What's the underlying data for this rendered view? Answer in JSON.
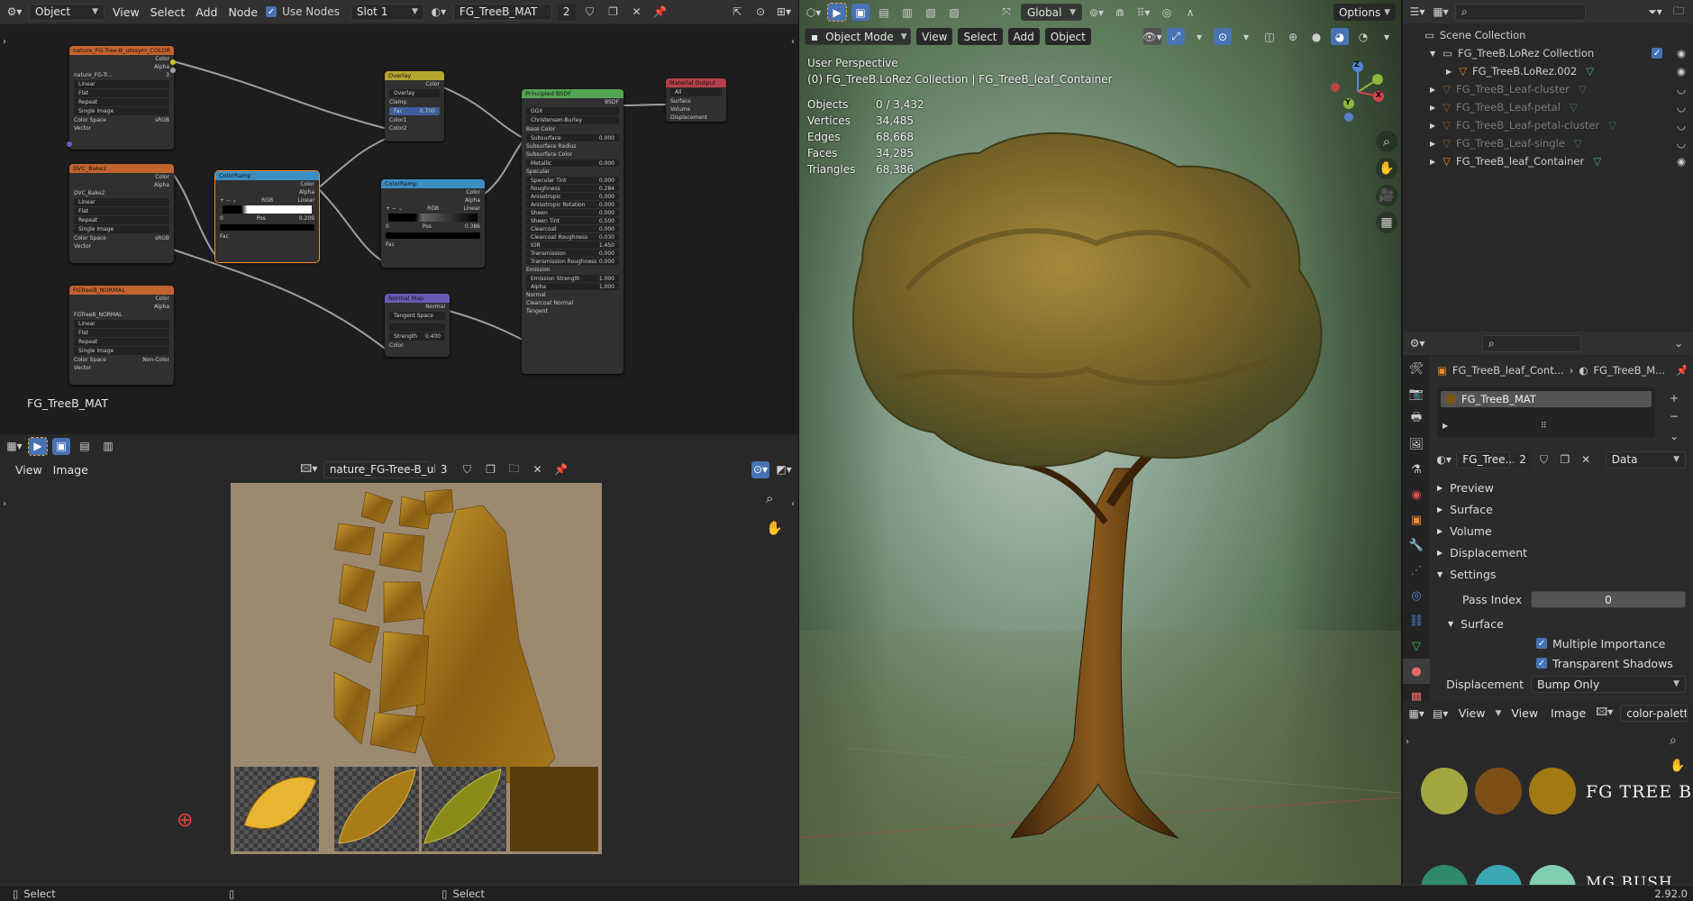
{
  "node_editor": {
    "header": {
      "mode": "Object",
      "menus": [
        "View",
        "Select",
        "Add",
        "Node"
      ],
      "use_nodes_label": "Use Nodes",
      "slot": "Slot 1",
      "material": "FG_TreeB_MAT",
      "users": "2"
    },
    "material_label": "FG_TreeB_MAT",
    "nodes": {
      "tex_color": {
        "title": "nature_FG-Tree-B_ulnsym_COLOR",
        "out1": "Color",
        "out2": "Alpha",
        "file": "nature_FG-Tr...",
        "users": "3",
        "interp": "Linear",
        "proj": "Flat",
        "ext": "Repeat",
        "src": "Single Image",
        "cs_label": "Color Space",
        "cs": "sRGB",
        "vector": "Vector"
      },
      "tex_bake": {
        "title": "DVC_Bake2",
        "out1": "Color",
        "out2": "Alpha",
        "file": "DVC_Bake2",
        "interp": "Linear",
        "proj": "Flat",
        "ext": "Repeat",
        "src": "Single Image",
        "cs_label": "Color Space",
        "cs": "sRGB",
        "vector": "Vector"
      },
      "tex_normal": {
        "title": "FGTreeB_NORMAL",
        "out1": "Color",
        "out2": "Alpha",
        "file": "FGTreeB_NORMAL",
        "interp": "Linear",
        "proj": "Flat",
        "ext": "Repeat",
        "src": "Single Image",
        "cs_label": "Color Space",
        "cs": "Non-Color",
        "vector": "Vector"
      },
      "ramp1": {
        "title": "ColorRamp",
        "out1": "Color",
        "out2": "Alpha",
        "mode": "RGB",
        "interp": "Linear",
        "idx": "0",
        "pos_label": "Pos",
        "pos": "0.209",
        "fac": "Fac"
      },
      "overlay": {
        "title": "Overlay",
        "out": "Color",
        "blend": "Overlay",
        "clamp": "Clamp",
        "fac_label": "Fac",
        "fac": "0.700",
        "c1": "Color1",
        "c2": "Color2"
      },
      "ramp2": {
        "title": "ColorRamp",
        "out1": "Color",
        "out2": "Alpha",
        "mode": "RGB",
        "interp": "Linear",
        "idx": "0",
        "pos_label": "Pos",
        "pos": "0.386",
        "fac": "Fac"
      },
      "normalmap": {
        "title": "Normal Map",
        "out": "Normal",
        "space": "Tangent Space",
        "strength_label": "Strength",
        "strength": "0.400",
        "color": "Color"
      },
      "bsdf": {
        "title": "Principled BSDF",
        "out": "BSDF",
        "dist": "GGX",
        "sss": "Christensen-Burley",
        "rows": [
          {
            "label": "Base Color",
            "value": ""
          },
          {
            "label": "Subsurface",
            "value": "0.000"
          },
          {
            "label": "Subsurface Radius",
            "value": ""
          },
          {
            "label": "Subsurface Color",
            "value": ""
          },
          {
            "label": "Metallic",
            "value": "0.000"
          },
          {
            "label": "Specular",
            "value": ""
          },
          {
            "label": "Specular Tint",
            "value": "0.000"
          },
          {
            "label": "Roughness",
            "value": "0.284"
          },
          {
            "label": "Anisotropic",
            "value": "0.000"
          },
          {
            "label": "Anisotropic Rotation",
            "value": "0.000"
          },
          {
            "label": "Sheen",
            "value": "0.000"
          },
          {
            "label": "Sheen Tint",
            "value": "0.500"
          },
          {
            "label": "Clearcoat",
            "value": "0.000"
          },
          {
            "label": "Clearcoat Roughness",
            "value": "0.030"
          },
          {
            "label": "IOR",
            "value": "1.450"
          },
          {
            "label": "Transmission",
            "value": "0.000"
          },
          {
            "label": "Transmission Roughness",
            "value": "0.000"
          },
          {
            "label": "Emission",
            "value": ""
          },
          {
            "label": "Emission Strength",
            "value": "1.000"
          },
          {
            "label": "Alpha",
            "value": "1.000"
          },
          {
            "label": "Normal",
            "value": ""
          },
          {
            "label": "Clearcoat Normal",
            "value": ""
          },
          {
            "label": "Tangent",
            "value": ""
          }
        ]
      },
      "output": {
        "title": "Material Output",
        "target": "All",
        "s1": "Surface",
        "s2": "Volume",
        "s3": "Displacement"
      }
    }
  },
  "image_editor": {
    "menus": [
      "View",
      "Image"
    ],
    "image_name": "nature_FG-Tree-B_ul...",
    "users": "3"
  },
  "viewport": {
    "mode": "Object Mode",
    "menus": [
      "View",
      "Select",
      "Add",
      "Object"
    ],
    "transform": "Global",
    "options": "Options",
    "overlay_title": "User Perspective",
    "overlay_subtitle": "(0) FG_TreeB.LoRez Collection | FG_TreeB_leaf_Container",
    "stats": [
      {
        "label": "Objects",
        "value": "0 / 3,432"
      },
      {
        "label": "Vertices",
        "value": "34,485"
      },
      {
        "label": "Edges",
        "value": "68,668"
      },
      {
        "label": "Faces",
        "value": "34,285"
      },
      {
        "label": "Triangles",
        "value": "68,386"
      }
    ],
    "gizmo": {
      "x": "X",
      "y": "Y",
      "z": "Z"
    }
  },
  "outliner": {
    "root": "Scene Collection",
    "items": [
      {
        "label": "FG_TreeB.LoRez Collection",
        "level": 0,
        "dim": false
      },
      {
        "label": "FG_TreeB.LoRez.002",
        "level": 1,
        "dim": false
      },
      {
        "label": "FG_TreeB_Leaf-cluster",
        "level": 0,
        "dim": true
      },
      {
        "label": "FG_TreeB_Leaf-petal",
        "level": 0,
        "dim": true
      },
      {
        "label": "FG_TreeB_Leaf-petal-cluster",
        "level": 0,
        "dim": true
      },
      {
        "label": "FG_TreeB_Leaf-single",
        "level": 0,
        "dim": true
      },
      {
        "label": "FG_TreeB_leaf_Container",
        "level": 0,
        "dim": false
      }
    ]
  },
  "properties": {
    "breadcrumb_object": "FG_TreeB_leaf_Cont...",
    "breadcrumb_material": "FG_TreeB_M...",
    "slot_material": "FG_TreeB_MAT",
    "material_field": "FG_Tree...",
    "users": "2",
    "link": "Data",
    "panels": [
      "Preview",
      "Surface",
      "Volume",
      "Displacement",
      "Settings"
    ],
    "pass_index_label": "Pass Index",
    "pass_index": "0",
    "surface_sub": "Surface",
    "multiple_importance": "Multiple Importance",
    "transparent_shadows": "Transparent Shadows",
    "displacement_label": "Displacement",
    "displacement_value": "Bump Only"
  },
  "palette": {
    "menus": [
      "View",
      "View",
      "Image"
    ],
    "image_name": "color-palette",
    "title": "FG TREE B",
    "subtitle": "MG BUSH",
    "swatches_top": [
      "#a4a63f",
      "#7c4f16",
      "#a37914"
    ],
    "swatches_bottom": [
      "#2f8a6a",
      "#3aa7b3",
      "#7fcfb0"
    ]
  },
  "statusbar": {
    "left": "Select",
    "middle": "Select",
    "version": "2.92.0"
  },
  "colors": {
    "accent": "#4772b3",
    "header": "#303030",
    "node_texture": "#c3632e",
    "node_shader": "#53a553",
    "node_output": "#b43f49",
    "node_converter": "#3b8ec4",
    "node_color": "#b5a531",
    "node_vector": "#6b59b6"
  }
}
